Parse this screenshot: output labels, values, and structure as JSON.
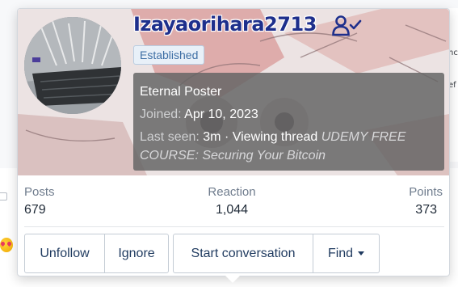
{
  "member": {
    "username": "Izayaorihara2713",
    "badge": "Established",
    "title": "Eternal Poster",
    "joined_label": "Joined:",
    "joined_value": "Apr 10, 2023",
    "last_seen_label": "Last seen:",
    "last_seen_value": "3m",
    "activity": "· Viewing thread",
    "thread_title": "UDEMY FREE COURSE: Securing Your Bitcoin"
  },
  "stats": [
    {
      "label": "Posts",
      "value": "679"
    },
    {
      "label": "Reaction",
      "value": "1,044"
    },
    {
      "label": "Points",
      "value": "373"
    }
  ],
  "actions": {
    "unfollow": "Unfollow",
    "ignore": "Ignore",
    "start_conversation": "Start conversation",
    "find": "Find"
  },
  "background": {
    "fragment_1": "nc",
    "fragment_2": "ef"
  },
  "icons": {
    "verified": "user-check-icon",
    "find_caret": "caret-down-icon",
    "emoji": "heart-eyes-emoji-icon"
  },
  "colors": {
    "username": "#1e2f8c",
    "badge_text": "#3e6fa5",
    "info_overlay": "#646464",
    "button_text": "#1f3a5f"
  }
}
